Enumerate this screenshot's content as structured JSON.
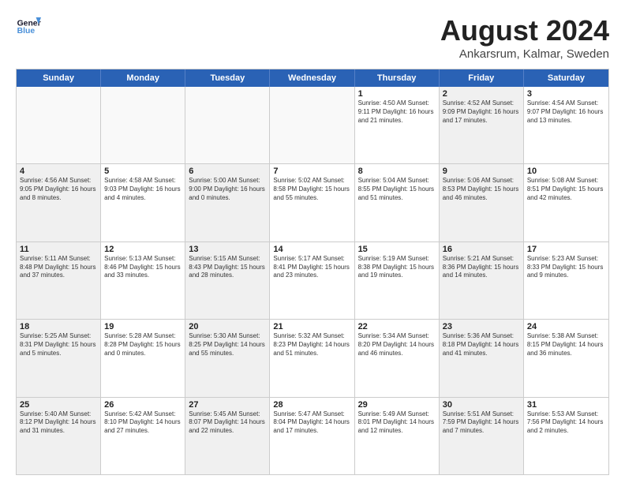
{
  "logo": {
    "line1": "General",
    "line2": "Blue"
  },
  "title": "August 2024",
  "subtitle": "Ankarsrum, Kalmar, Sweden",
  "headers": [
    "Sunday",
    "Monday",
    "Tuesday",
    "Wednesday",
    "Thursday",
    "Friday",
    "Saturday"
  ],
  "weeks": [
    [
      {
        "day": "",
        "text": "",
        "shaded": false,
        "empty": true
      },
      {
        "day": "",
        "text": "",
        "shaded": false,
        "empty": true
      },
      {
        "day": "",
        "text": "",
        "shaded": false,
        "empty": true
      },
      {
        "day": "",
        "text": "",
        "shaded": false,
        "empty": true
      },
      {
        "day": "1",
        "text": "Sunrise: 4:50 AM\nSunset: 9:11 PM\nDaylight: 16 hours\nand 21 minutes.",
        "shaded": false,
        "empty": false
      },
      {
        "day": "2",
        "text": "Sunrise: 4:52 AM\nSunset: 9:09 PM\nDaylight: 16 hours\nand 17 minutes.",
        "shaded": true,
        "empty": false
      },
      {
        "day": "3",
        "text": "Sunrise: 4:54 AM\nSunset: 9:07 PM\nDaylight: 16 hours\nand 13 minutes.",
        "shaded": false,
        "empty": false
      }
    ],
    [
      {
        "day": "4",
        "text": "Sunrise: 4:56 AM\nSunset: 9:05 PM\nDaylight: 16 hours\nand 8 minutes.",
        "shaded": true,
        "empty": false
      },
      {
        "day": "5",
        "text": "Sunrise: 4:58 AM\nSunset: 9:03 PM\nDaylight: 16 hours\nand 4 minutes.",
        "shaded": false,
        "empty": false
      },
      {
        "day": "6",
        "text": "Sunrise: 5:00 AM\nSunset: 9:00 PM\nDaylight: 16 hours\nand 0 minutes.",
        "shaded": true,
        "empty": false
      },
      {
        "day": "7",
        "text": "Sunrise: 5:02 AM\nSunset: 8:58 PM\nDaylight: 15 hours\nand 55 minutes.",
        "shaded": false,
        "empty": false
      },
      {
        "day": "8",
        "text": "Sunrise: 5:04 AM\nSunset: 8:55 PM\nDaylight: 15 hours\nand 51 minutes.",
        "shaded": false,
        "empty": false
      },
      {
        "day": "9",
        "text": "Sunrise: 5:06 AM\nSunset: 8:53 PM\nDaylight: 15 hours\nand 46 minutes.",
        "shaded": true,
        "empty": false
      },
      {
        "day": "10",
        "text": "Sunrise: 5:08 AM\nSunset: 8:51 PM\nDaylight: 15 hours\nand 42 minutes.",
        "shaded": false,
        "empty": false
      }
    ],
    [
      {
        "day": "11",
        "text": "Sunrise: 5:11 AM\nSunset: 8:48 PM\nDaylight: 15 hours\nand 37 minutes.",
        "shaded": true,
        "empty": false
      },
      {
        "day": "12",
        "text": "Sunrise: 5:13 AM\nSunset: 8:46 PM\nDaylight: 15 hours\nand 33 minutes.",
        "shaded": false,
        "empty": false
      },
      {
        "day": "13",
        "text": "Sunrise: 5:15 AM\nSunset: 8:43 PM\nDaylight: 15 hours\nand 28 minutes.",
        "shaded": true,
        "empty": false
      },
      {
        "day": "14",
        "text": "Sunrise: 5:17 AM\nSunset: 8:41 PM\nDaylight: 15 hours\nand 23 minutes.",
        "shaded": false,
        "empty": false
      },
      {
        "day": "15",
        "text": "Sunrise: 5:19 AM\nSunset: 8:38 PM\nDaylight: 15 hours\nand 19 minutes.",
        "shaded": false,
        "empty": false
      },
      {
        "day": "16",
        "text": "Sunrise: 5:21 AM\nSunset: 8:36 PM\nDaylight: 15 hours\nand 14 minutes.",
        "shaded": true,
        "empty": false
      },
      {
        "day": "17",
        "text": "Sunrise: 5:23 AM\nSunset: 8:33 PM\nDaylight: 15 hours\nand 9 minutes.",
        "shaded": false,
        "empty": false
      }
    ],
    [
      {
        "day": "18",
        "text": "Sunrise: 5:25 AM\nSunset: 8:31 PM\nDaylight: 15 hours\nand 5 minutes.",
        "shaded": true,
        "empty": false
      },
      {
        "day": "19",
        "text": "Sunrise: 5:28 AM\nSunset: 8:28 PM\nDaylight: 15 hours\nand 0 minutes.",
        "shaded": false,
        "empty": false
      },
      {
        "day": "20",
        "text": "Sunrise: 5:30 AM\nSunset: 8:25 PM\nDaylight: 14 hours\nand 55 minutes.",
        "shaded": true,
        "empty": false
      },
      {
        "day": "21",
        "text": "Sunrise: 5:32 AM\nSunset: 8:23 PM\nDaylight: 14 hours\nand 51 minutes.",
        "shaded": false,
        "empty": false
      },
      {
        "day": "22",
        "text": "Sunrise: 5:34 AM\nSunset: 8:20 PM\nDaylight: 14 hours\nand 46 minutes.",
        "shaded": false,
        "empty": false
      },
      {
        "day": "23",
        "text": "Sunrise: 5:36 AM\nSunset: 8:18 PM\nDaylight: 14 hours\nand 41 minutes.",
        "shaded": true,
        "empty": false
      },
      {
        "day": "24",
        "text": "Sunrise: 5:38 AM\nSunset: 8:15 PM\nDaylight: 14 hours\nand 36 minutes.",
        "shaded": false,
        "empty": false
      }
    ],
    [
      {
        "day": "25",
        "text": "Sunrise: 5:40 AM\nSunset: 8:12 PM\nDaylight: 14 hours\nand 31 minutes.",
        "shaded": true,
        "empty": false
      },
      {
        "day": "26",
        "text": "Sunrise: 5:42 AM\nSunset: 8:10 PM\nDaylight: 14 hours\nand 27 minutes.",
        "shaded": false,
        "empty": false
      },
      {
        "day": "27",
        "text": "Sunrise: 5:45 AM\nSunset: 8:07 PM\nDaylight: 14 hours\nand 22 minutes.",
        "shaded": true,
        "empty": false
      },
      {
        "day": "28",
        "text": "Sunrise: 5:47 AM\nSunset: 8:04 PM\nDaylight: 14 hours\nand 17 minutes.",
        "shaded": false,
        "empty": false
      },
      {
        "day": "29",
        "text": "Sunrise: 5:49 AM\nSunset: 8:01 PM\nDaylight: 14 hours\nand 12 minutes.",
        "shaded": false,
        "empty": false
      },
      {
        "day": "30",
        "text": "Sunrise: 5:51 AM\nSunset: 7:59 PM\nDaylight: 14 hours\nand 7 minutes.",
        "shaded": true,
        "empty": false
      },
      {
        "day": "31",
        "text": "Sunrise: 5:53 AM\nSunset: 7:56 PM\nDaylight: 14 hours\nand 2 minutes.",
        "shaded": false,
        "empty": false
      }
    ]
  ]
}
